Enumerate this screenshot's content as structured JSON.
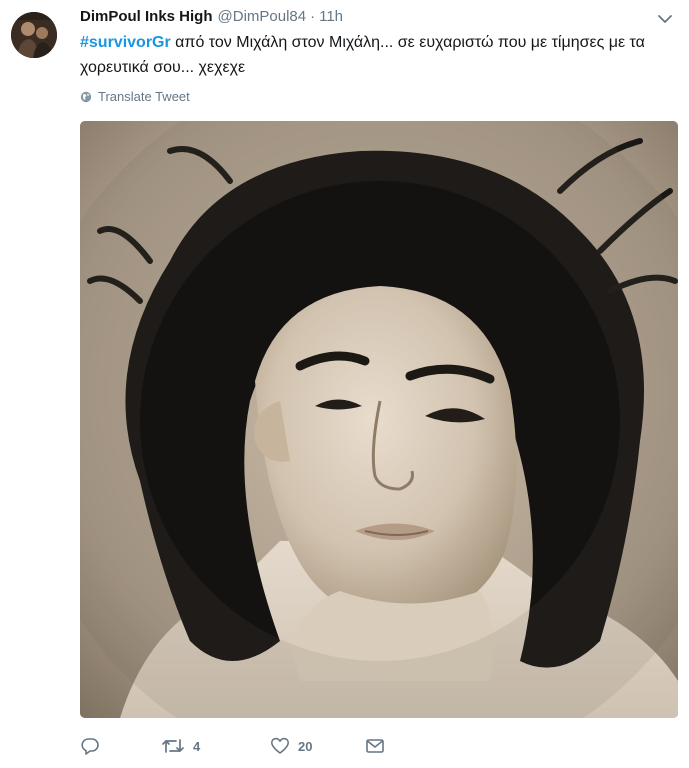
{
  "tweet": {
    "display_name": "DimPoul Inks High",
    "handle": "@DimPoul84",
    "separator": "·",
    "time": "11h",
    "hashtag": "#survivorGr",
    "text": " από τον Μιχάλη στον Μιχάλη... σε ευχαριστώ που με τίμησες με τα χορευτικά σου... χεχεχε",
    "translate_label": "Translate Tweet",
    "media": {
      "description": "black-and-white portrait photo"
    },
    "actions": {
      "reply_count": "",
      "retweet_count": "4",
      "like_count": "20"
    },
    "icons": {
      "caret": "chevron-down-icon",
      "globe": "globe-icon",
      "reply": "reply-icon",
      "retweet": "retweet-icon",
      "like": "heart-icon",
      "dm": "envelope-icon"
    },
    "colors": {
      "hashtag": "#1b95e0",
      "secondary_text": "#657786",
      "primary_text": "#14171a"
    }
  }
}
